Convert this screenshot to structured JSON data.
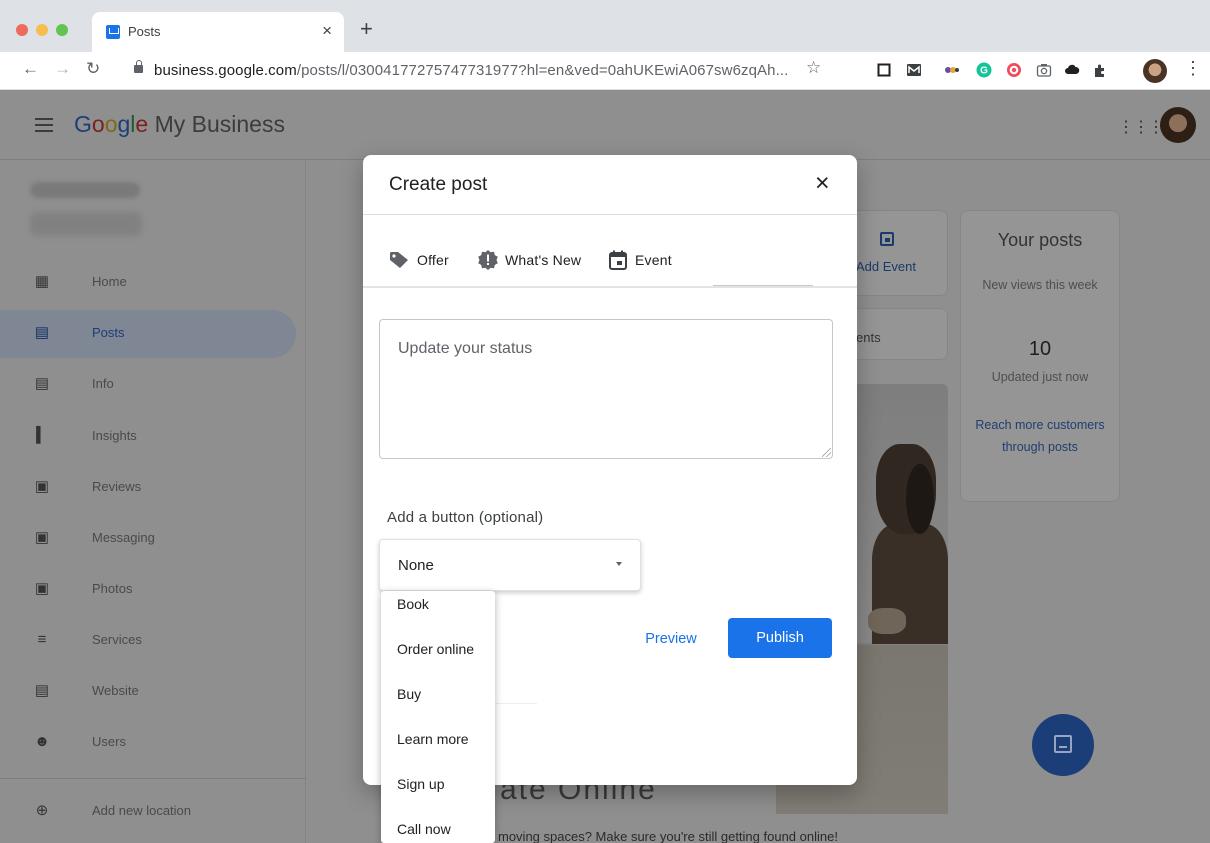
{
  "browser": {
    "tab_title": "Posts",
    "tab_close": "×",
    "new_tab": "+",
    "url_host": "business.google.com",
    "url_path": "/posts/l/03004177275747731977?hl=en&ved=0ahUKEwiA067sw6zqAh...",
    "traffic_colors": [
      "#ed6a5e",
      "#f5bf4f",
      "#61c554"
    ]
  },
  "app": {
    "brand_product": "My Business",
    "brand_google": [
      "G",
      "o",
      "o",
      "g",
      "l",
      "e"
    ],
    "sidebar": {
      "items": [
        {
          "label": "Home",
          "icon": "dashboard-icon"
        },
        {
          "label": "Posts",
          "icon": "posts-icon",
          "active": true
        },
        {
          "label": "Info",
          "icon": "storefront-icon"
        },
        {
          "label": "Insights",
          "icon": "bar-chart-icon"
        },
        {
          "label": "Reviews",
          "icon": "reviews-icon"
        },
        {
          "label": "Messaging",
          "icon": "message-icon"
        },
        {
          "label": "Photos",
          "icon": "photos-icon"
        },
        {
          "label": "Services",
          "icon": "list-icon"
        },
        {
          "label": "Website",
          "icon": "website-icon"
        },
        {
          "label": "Users",
          "icon": "add-user-icon"
        }
      ],
      "add_location": "Add new location"
    },
    "main": {
      "add_event": "Add Event",
      "events_partial": "ents",
      "headline_partial": "ate Online",
      "caption_partial": "moving spaces? Make sure you're still getting found online!"
    },
    "your_posts": {
      "title": "Your posts",
      "subtitle": "New views this week",
      "count": "10",
      "updated": "Updated just now",
      "link": "Reach more customers through posts"
    }
  },
  "modal": {
    "title": "Create post",
    "close": "×",
    "post_types": [
      "Offer",
      "What's New",
      "Event"
    ],
    "status_placeholder": "Update your status",
    "button_label": "Add a button (optional)",
    "button_selected": "None",
    "button_options": [
      "Book",
      "Order online",
      "Buy",
      "Learn more",
      "Sign up",
      "Call now"
    ],
    "preview": "Preview",
    "publish": "Publish"
  },
  "colors": {
    "accent": "#1a73e8",
    "overlay_gray": "#8f8f8f"
  }
}
